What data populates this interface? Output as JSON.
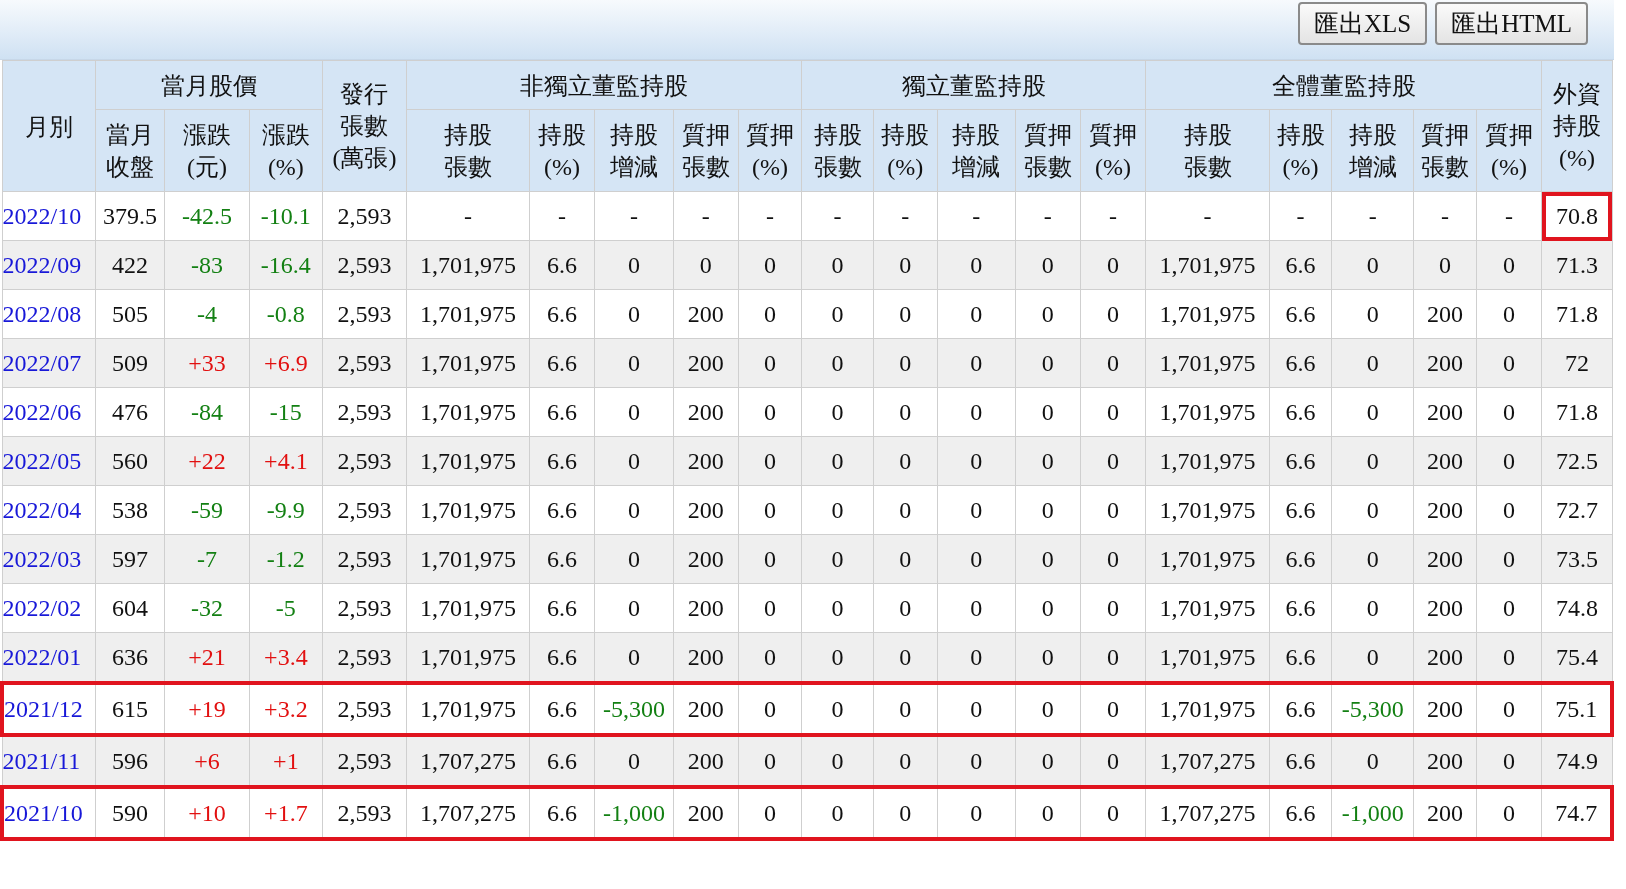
{
  "toolbar": {
    "buttons": [
      {
        "label": "匯出XLS"
      },
      {
        "label": "匯出HTML"
      }
    ]
  },
  "table": {
    "columns": [
      {
        "label": "月別"
      },
      {
        "group": "當月股價",
        "items": [
          "當月收盤",
          "漲跌(元)",
          "漲跌(%)"
        ]
      },
      {
        "label": "發行張數(萬張)"
      },
      {
        "group": "非獨立董監持股",
        "items": [
          "持股張數",
          "持股(%)",
          "持股增減",
          "質押張數",
          "質押(%)"
        ]
      },
      {
        "group": "獨立董監持股",
        "items": [
          "持股張數",
          "持股(%)",
          "持股增減",
          "質押張數",
          "質押(%)"
        ]
      },
      {
        "group": "全體董監持股",
        "items": [
          "持股張數",
          "持股(%)",
          "持股增減",
          "質押張數",
          "質押(%)"
        ]
      },
      {
        "label": "外資持股(%)"
      }
    ],
    "rows": [
      {
        "month": "2022/10",
        "price_up": false,
        "holding_cut": false,
        "row_highlighted": false,
        "last_cell_highlighted": true,
        "values": [
          "379.5",
          "-42.5",
          "-10.1",
          "2,593",
          "-",
          "-",
          "-",
          "-",
          "-",
          "-",
          "-",
          "-",
          "-",
          "-",
          "-",
          "-",
          "-",
          "-",
          "-",
          "70.8"
        ]
      },
      {
        "month": "2022/09",
        "price_up": false,
        "holding_cut": false,
        "row_highlighted": false,
        "last_cell_highlighted": false,
        "values": [
          "422",
          "-83",
          "-16.4",
          "2,593",
          "1,701,975",
          "6.6",
          "0",
          "0",
          "0",
          "0",
          "0",
          "0",
          "0",
          "0",
          "1,701,975",
          "6.6",
          "0",
          "0",
          "0",
          "71.3"
        ]
      },
      {
        "month": "2022/08",
        "price_up": false,
        "holding_cut": false,
        "row_highlighted": false,
        "last_cell_highlighted": false,
        "values": [
          "505",
          "-4",
          "-0.8",
          "2,593",
          "1,701,975",
          "6.6",
          "0",
          "200",
          "0",
          "0",
          "0",
          "0",
          "0",
          "0",
          "1,701,975",
          "6.6",
          "0",
          "200",
          "0",
          "71.8"
        ]
      },
      {
        "month": "2022/07",
        "price_up": true,
        "holding_cut": false,
        "row_highlighted": false,
        "last_cell_highlighted": false,
        "values": [
          "509",
          "+33",
          "+6.9",
          "2,593",
          "1,701,975",
          "6.6",
          "0",
          "200",
          "0",
          "0",
          "0",
          "0",
          "0",
          "0",
          "1,701,975",
          "6.6",
          "0",
          "200",
          "0",
          "72"
        ]
      },
      {
        "month": "2022/06",
        "price_up": false,
        "holding_cut": false,
        "row_highlighted": false,
        "last_cell_highlighted": false,
        "values": [
          "476",
          "-84",
          "-15",
          "2,593",
          "1,701,975",
          "6.6",
          "0",
          "200",
          "0",
          "0",
          "0",
          "0",
          "0",
          "0",
          "1,701,975",
          "6.6",
          "0",
          "200",
          "0",
          "71.8"
        ]
      },
      {
        "month": "2022/05",
        "price_up": true,
        "holding_cut": false,
        "row_highlighted": false,
        "last_cell_highlighted": false,
        "values": [
          "560",
          "+22",
          "+4.1",
          "2,593",
          "1,701,975",
          "6.6",
          "0",
          "200",
          "0",
          "0",
          "0",
          "0",
          "0",
          "0",
          "1,701,975",
          "6.6",
          "0",
          "200",
          "0",
          "72.5"
        ]
      },
      {
        "month": "2022/04",
        "price_up": false,
        "holding_cut": false,
        "row_highlighted": false,
        "last_cell_highlighted": false,
        "values": [
          "538",
          "-59",
          "-9.9",
          "2,593",
          "1,701,975",
          "6.6",
          "0",
          "200",
          "0",
          "0",
          "0",
          "0",
          "0",
          "0",
          "1,701,975",
          "6.6",
          "0",
          "200",
          "0",
          "72.7"
        ]
      },
      {
        "month": "2022/03",
        "price_up": false,
        "holding_cut": false,
        "row_highlighted": false,
        "last_cell_highlighted": false,
        "values": [
          "597",
          "-7",
          "-1.2",
          "2,593",
          "1,701,975",
          "6.6",
          "0",
          "200",
          "0",
          "0",
          "0",
          "0",
          "0",
          "0",
          "1,701,975",
          "6.6",
          "0",
          "200",
          "0",
          "73.5"
        ]
      },
      {
        "month": "2022/02",
        "price_up": false,
        "holding_cut": false,
        "row_highlighted": false,
        "last_cell_highlighted": false,
        "values": [
          "604",
          "-32",
          "-5",
          "2,593",
          "1,701,975",
          "6.6",
          "0",
          "200",
          "0",
          "0",
          "0",
          "0",
          "0",
          "0",
          "1,701,975",
          "6.6",
          "0",
          "200",
          "0",
          "74.8"
        ]
      },
      {
        "month": "2022/01",
        "price_up": true,
        "holding_cut": false,
        "row_highlighted": false,
        "last_cell_highlighted": false,
        "values": [
          "636",
          "+21",
          "+3.4",
          "2,593",
          "1,701,975",
          "6.6",
          "0",
          "200",
          "0",
          "0",
          "0",
          "0",
          "0",
          "0",
          "1,701,975",
          "6.6",
          "0",
          "200",
          "0",
          "75.4"
        ]
      },
      {
        "month": "2021/12",
        "price_up": true,
        "holding_cut": true,
        "row_highlighted": true,
        "last_cell_highlighted": false,
        "values": [
          "615",
          "+19",
          "+3.2",
          "2,593",
          "1,701,975",
          "6.6",
          "-5,300",
          "200",
          "0",
          "0",
          "0",
          "0",
          "0",
          "0",
          "1,701,975",
          "6.6",
          "-5,300",
          "200",
          "0",
          "75.1"
        ]
      },
      {
        "month": "2021/11",
        "price_up": true,
        "holding_cut": false,
        "row_highlighted": false,
        "last_cell_highlighted": false,
        "values": [
          "596",
          "+6",
          "+1",
          "2,593",
          "1,707,275",
          "6.6",
          "0",
          "200",
          "0",
          "0",
          "0",
          "0",
          "0",
          "0",
          "1,707,275",
          "6.6",
          "0",
          "200",
          "0",
          "74.9"
        ]
      },
      {
        "month": "2021/10",
        "price_up": true,
        "holding_cut": true,
        "row_highlighted": true,
        "last_cell_highlighted": false,
        "values": [
          "590",
          "+10",
          "+1.7",
          "2,593",
          "1,707,275",
          "6.6",
          "-1,000",
          "200",
          "0",
          "0",
          "0",
          "0",
          "0",
          "0",
          "1,707,275",
          "6.6",
          "-1,000",
          "200",
          "0",
          "74.7"
        ]
      }
    ]
  }
}
